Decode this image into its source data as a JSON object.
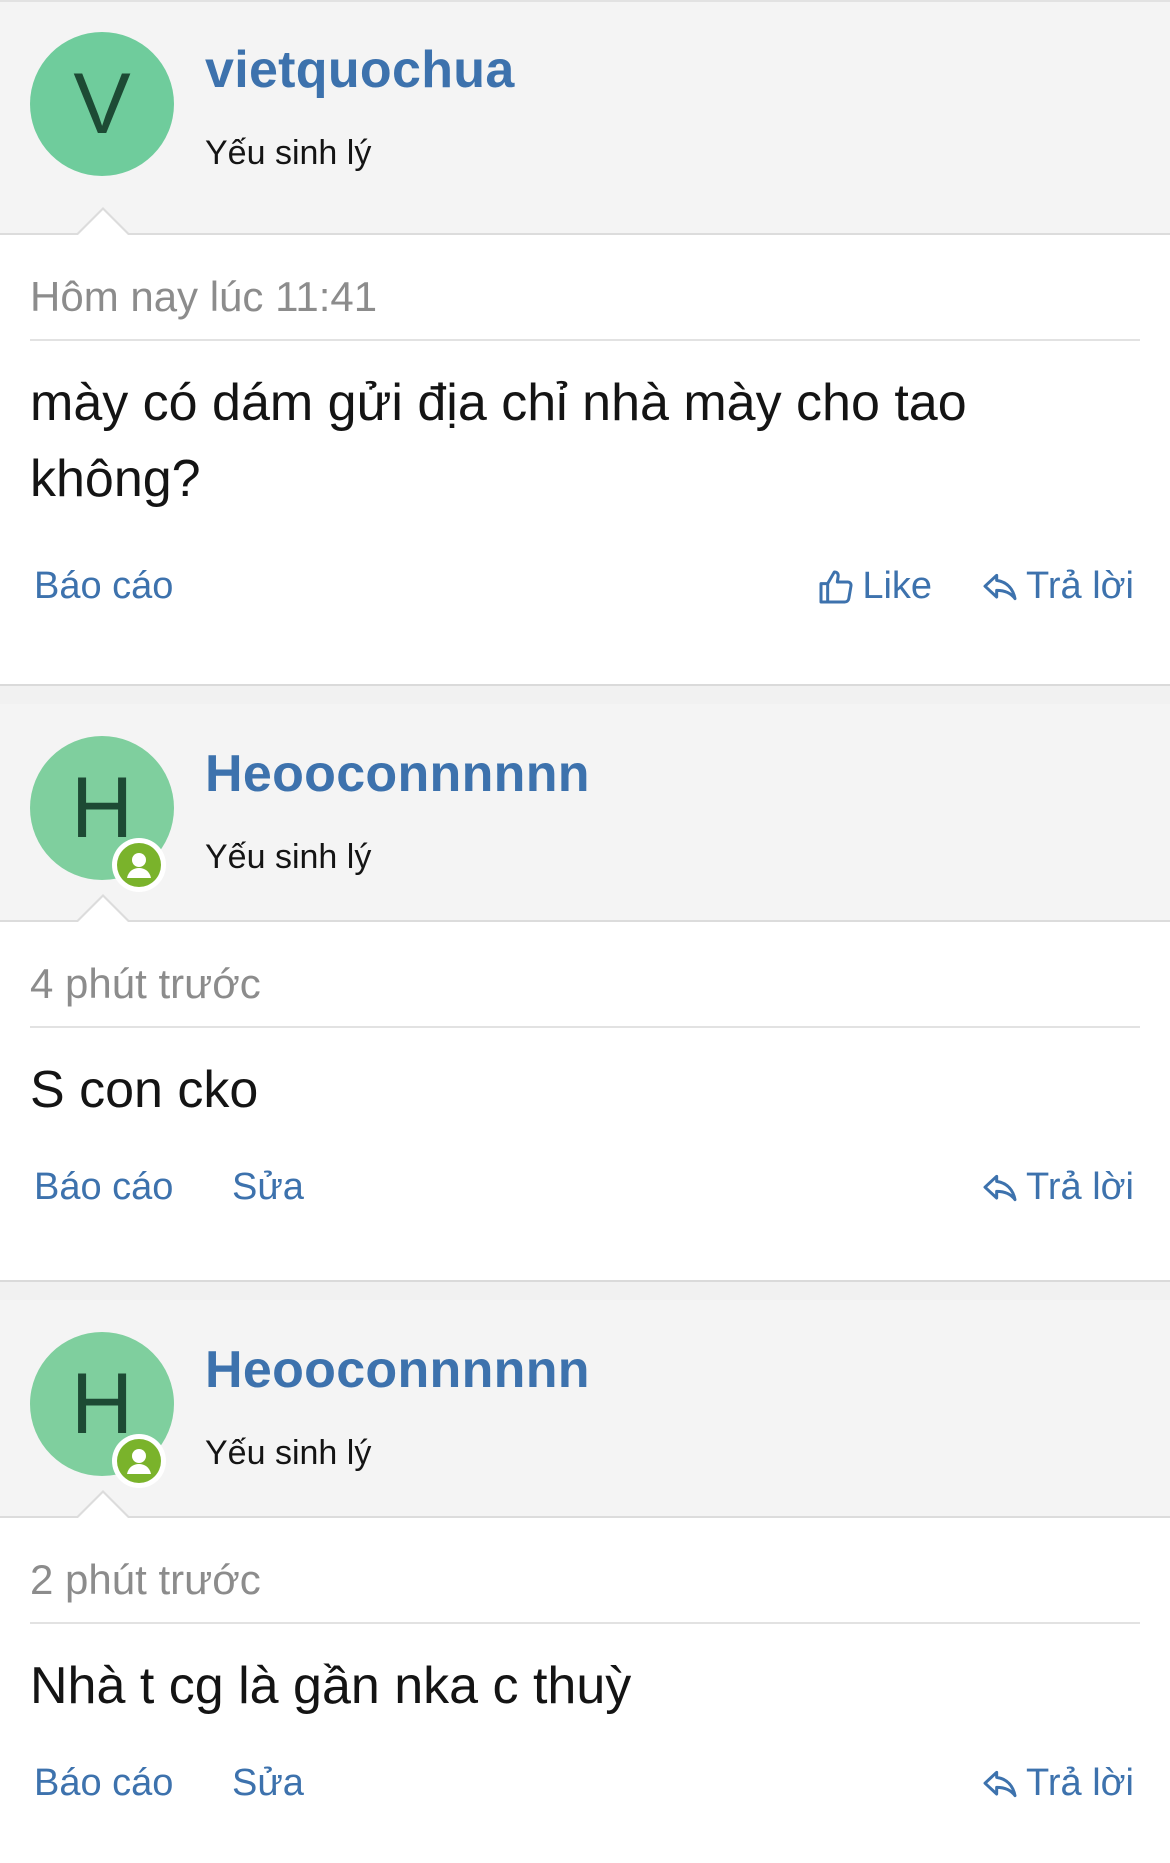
{
  "posts": [
    {
      "avatar_letter": "V",
      "username": "vietquochua",
      "user_title": "Yếu sinh lý",
      "timestamp": "Hôm nay lúc 11:41",
      "message": "mày có dám gửi địa chỉ nhà mày cho tao không?",
      "actions": {
        "report": "Báo cáo",
        "like": "Like",
        "reply": "Trả lời"
      }
    },
    {
      "avatar_letter": "H",
      "username": "Heooconnnnnn",
      "user_title": "Yếu sinh lý",
      "timestamp": "4 phút trước",
      "message": "S con cko",
      "actions": {
        "report": "Báo cáo",
        "edit": "Sửa",
        "reply": "Trả lời"
      }
    },
    {
      "avatar_letter": "H",
      "username": "Heooconnnnnn",
      "user_title": "Yếu sinh lý",
      "timestamp": "2 phút trước",
      "message": "Nhà t cg là gần nka c thuỳ",
      "actions": {
        "report": "Báo cáo",
        "edit": "Sửa",
        "reply": "Trả lời"
      }
    }
  ],
  "colors": {
    "link": "#3d72ad",
    "avatar_v": "#6fcc9c",
    "avatar_h": "#7fcf9e",
    "online_badge": "#7ab32b"
  }
}
